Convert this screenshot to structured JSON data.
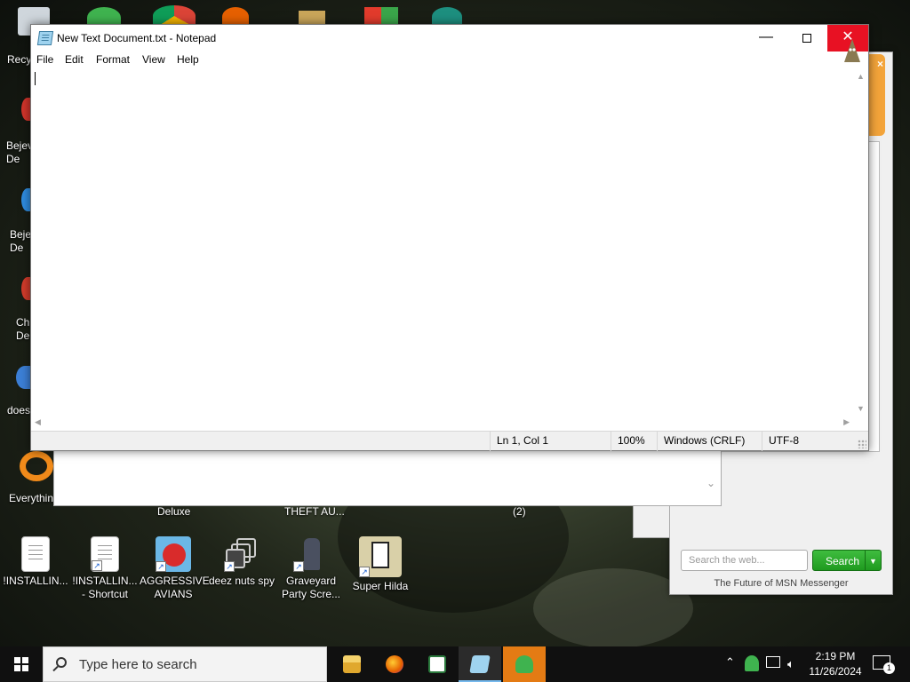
{
  "notepad": {
    "title": "New Text Document.txt - Notepad",
    "menu": [
      "File",
      "Edit",
      "Format",
      "View",
      "Help"
    ],
    "content": "",
    "status": {
      "position": "Ln 1, Col 1",
      "zoom": "100%",
      "line_ending": "Windows (CRLF)",
      "encoding": "UTF-8"
    }
  },
  "desktop": {
    "left_edge_labels": [
      "Recy",
      "Bejev\nDe",
      "Beje\nDe",
      "Ch\nDe",
      "does",
      "Everythin"
    ],
    "partial_labels": [
      "Deluxe",
      "THEFT AU...",
      "(2)"
    ],
    "icons": [
      {
        "label": "!INSTALLIN...",
        "icon": "text-file-icon",
        "shortcut": false
      },
      {
        "label": "!INSTALLIN... - Shortcut",
        "icon": "text-file-icon",
        "shortcut": true
      },
      {
        "label": "AGGRESSIVE AVIANS",
        "icon": "angry-bird-icon",
        "shortcut": true
      },
      {
        "label": "deez nuts spy",
        "icon": "stacked-windows-icon",
        "shortcut": true
      },
      {
        "label": "Graveyard Party Scre...",
        "icon": "robot-figure-icon",
        "shortcut": true
      },
      {
        "label": "Super Hilda",
        "icon": "pixel-character-icon",
        "shortcut": true
      }
    ]
  },
  "msn": {
    "search_placeholder": "Search the web...",
    "search_button": "Search",
    "tagline": "The Future of MSN Messenger"
  },
  "taskbar": {
    "search_placeholder": "Type here to search",
    "apps": [
      "file-explorer-icon",
      "firefox-icon",
      "wordpad-icon",
      "notepad-icon",
      "msn-messenger-icon"
    ],
    "time": "2:19 PM",
    "date": "11/26/2024",
    "notification_count": "1"
  },
  "colors": {
    "close_red": "#e81123",
    "taskbar": "#101010",
    "msn_highlight": "#e47b14",
    "msn_search_green": "#2aa62a"
  }
}
